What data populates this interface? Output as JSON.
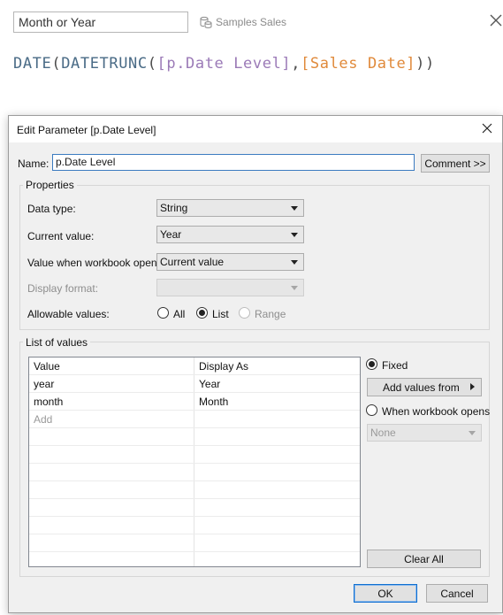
{
  "calc_editor": {
    "name_value": "Month or Year",
    "datasource_label": "Samples Sales",
    "formula_tokens": [
      {
        "text": "DATE",
        "kind": "fn"
      },
      {
        "text": "(",
        "kind": "paren"
      },
      {
        "text": "DATETRUNC",
        "kind": "fn"
      },
      {
        "text": "(",
        "kind": "paren"
      },
      {
        "text": "[p.Date Level]",
        "kind": "param"
      },
      {
        "text": ",",
        "kind": "paren"
      },
      {
        "text": "[Sales Date]",
        "kind": "field"
      },
      {
        "text": "))",
        "kind": "paren"
      }
    ]
  },
  "dialog": {
    "title": "Edit Parameter [p.Date Level]",
    "name_label": "Name:",
    "name_value": "p.Date Level",
    "comment_button": "Comment >>",
    "properties_title": "Properties",
    "data_type_label": "Data type:",
    "data_type_value": "String",
    "current_value_label": "Current value:",
    "current_value_value": "Year",
    "workbook_opens_label": "Value when workbook opens:",
    "workbook_opens_value": "Current value",
    "display_format_label": "Display format:",
    "display_format_value": "",
    "allowable_label": "Allowable values:",
    "allowable_options": [
      "All",
      "List",
      "Range"
    ],
    "allowable_selected": "List",
    "list_title": "List of values",
    "table": {
      "headers": [
        "Value",
        "Display As"
      ],
      "rows": [
        [
          "year",
          "Year"
        ],
        [
          "month",
          "Month"
        ]
      ],
      "add_placeholder": "Add"
    },
    "fixed_label": "Fixed",
    "fixed_selected": true,
    "add_values_from_button": "Add values from",
    "when_opens_label": "When workbook opens",
    "when_opens_selected": false,
    "when_opens_combo_value": "None",
    "clear_all_button": "Clear All",
    "ok_button": "OK",
    "cancel_button": "Cancel"
  },
  "colors": {
    "formula_function": "#4a6b86",
    "formula_parameter": "#9b7ab7",
    "formula_field": "#e08a3b",
    "focus_border": "#3b7bc0"
  }
}
